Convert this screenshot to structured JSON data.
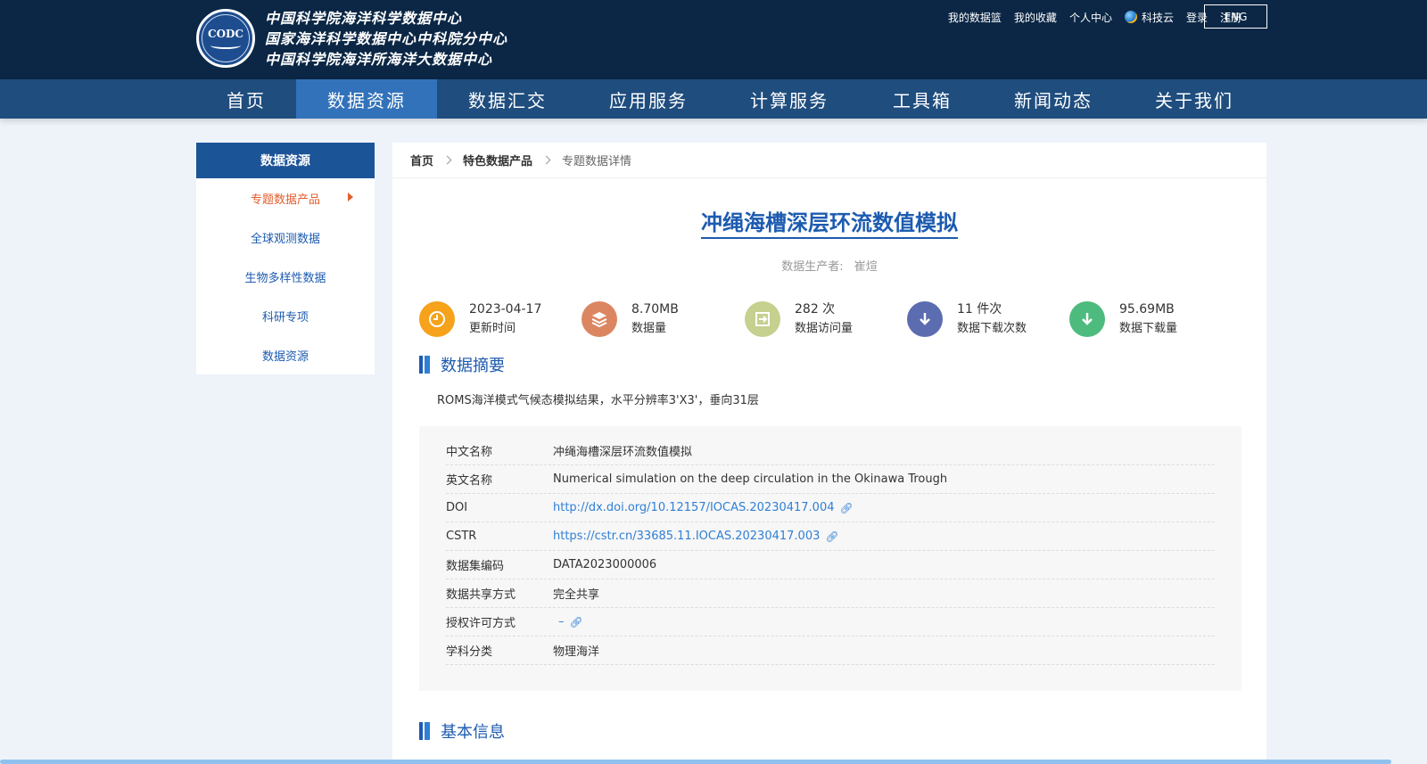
{
  "header": {
    "logo_text": "CODC",
    "org_names": [
      "中国科学院海洋科学数据中心",
      "国家海洋科学数据中心中科院分中心",
      "中国科学院海洋所海洋大数据中心"
    ],
    "top_links": [
      {
        "label": "我的数据篮"
      },
      {
        "label": "我的收藏"
      },
      {
        "label": "个人中心"
      },
      {
        "label": "科技云",
        "icon": "globe-icon"
      },
      {
        "label": "登录"
      },
      {
        "label": "注册"
      }
    ],
    "lang_button": "ENG"
  },
  "nav": {
    "items": [
      {
        "label": "首页",
        "active": false
      },
      {
        "label": "数据资源",
        "active": true
      },
      {
        "label": "数据汇交",
        "active": false
      },
      {
        "label": "应用服务",
        "active": false
      },
      {
        "label": "计算服务",
        "active": false
      },
      {
        "label": "工具箱",
        "active": false
      },
      {
        "label": "新闻动态",
        "active": false
      },
      {
        "label": "关于我们",
        "active": false
      }
    ]
  },
  "sidebar": {
    "title": "数据资源",
    "items": [
      {
        "label": "专题数据产品",
        "active": true
      },
      {
        "label": "全球观测数据",
        "active": false
      },
      {
        "label": "生物多样性数据",
        "active": false
      },
      {
        "label": "科研专项",
        "active": false
      },
      {
        "label": "数据资源",
        "active": false
      }
    ]
  },
  "breadcrumb": {
    "home": "首页",
    "category": "特色数据产品",
    "current": "专题数据详情"
  },
  "dataset": {
    "title": "冲绳海槽深层环流数值模拟",
    "producer_label": "数据生产者:",
    "producer_value": "崔煊",
    "stats": [
      {
        "value": "2023-04-17",
        "label": "更新时间",
        "icon": "clock-icon",
        "color": "#f6a21a"
      },
      {
        "value": "8.70MB",
        "label": "数据量",
        "icon": "layers-icon",
        "color": "#dc8661"
      },
      {
        "value": "282 次",
        "label": "数据访问量",
        "icon": "visit-icon",
        "color": "#c6d08f"
      },
      {
        "value": "11 件次",
        "label": "数据下载次数",
        "icon": "download-count-icon",
        "color": "#5c6cb0"
      },
      {
        "value": "95.69MB",
        "label": "数据下载量",
        "icon": "download-icon",
        "color": "#4dbb7d"
      }
    ],
    "abstract_title": "数据摘要",
    "abstract_text": "ROMS海洋模式气候态模拟结果，水平分辨率3'X3'，垂向31层",
    "info": {
      "cn_name_label": "中文名称",
      "cn_name": "冲绳海槽深层环流数值模拟",
      "en_name_label": "英文名称",
      "en_name": "Numerical simulation on the deep circulation in the Okinawa Trough",
      "doi_label": "DOI",
      "doi": "http://dx.doi.org/10.12157/IOCAS.20230417.004",
      "cstr_label": "CSTR",
      "cstr": "https://cstr.cn/33685.11.IOCAS.20230417.003",
      "code_label": "数据集编码",
      "code": "DATA2023000006",
      "share_label": "数据共享方式",
      "share": "完全共享",
      "license_label": "授权许可方式",
      "license": "–",
      "subject_label": "学科分类",
      "subject": "物理海洋"
    },
    "basic_title": "基本信息"
  }
}
